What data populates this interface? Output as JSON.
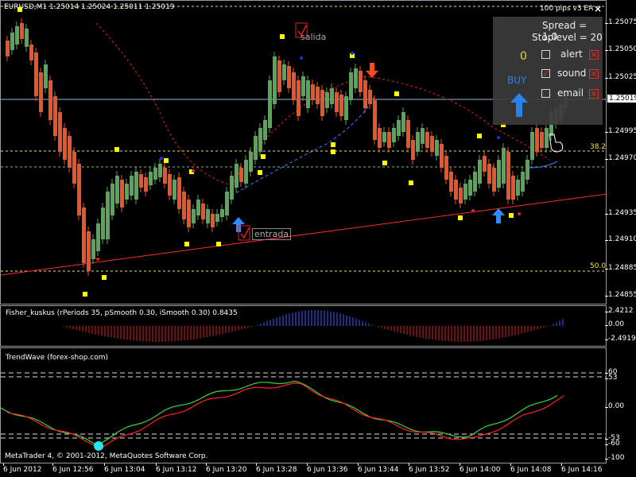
{
  "main": {
    "symbol_header": "EURUSD,M1  1.25014 1.25024 1.25011 1.25019",
    "ea_title": "100 pips v3 EA",
    "close_glyph": "×",
    "current_price": "1.25019",
    "y_ticks": [
      "1.25075",
      "1.25050",
      "1.25025",
      "1.24995",
      "1.24970",
      "1.24935",
      "1.24910",
      "1.24885",
      "1.24855"
    ],
    "fib_38": "38.2",
    "fib_50": "50.0",
    "salida_label": "salida",
    "entrada_label": "entrada"
  },
  "ea_panel": {
    "spread": "Spread = 1.0",
    "stoplevel": "Stoplevel = 20",
    "counter": "0",
    "alert_label": "alert",
    "sound_label": "sound",
    "email_label": "email",
    "buy_label": "BUY",
    "x_glyph": "×",
    "check_glyph": "✓"
  },
  "fisher": {
    "header": "Fisher_kuskus  (rPeriods 35, pSmooth 0.30, iSmooth 0.30)   0.8435",
    "y_ticks": [
      "2.4212",
      "0.00",
      "-2.4919"
    ]
  },
  "trendwave": {
    "header": "TrendWave (forex-shop.com)",
    "y_ticks": [
      "60",
      "53",
      "0.00",
      "-53",
      "-60",
      "-100"
    ],
    "copyright": "MetaTrader 4, © 2001-2012, MetaQuotes Software Corp."
  },
  "x_axis": [
    "6 Jun 2012",
    "6 Jun 12:56",
    "6 Jun 13:04",
    "6 Jun 13:12",
    "6 Jun 13:20",
    "6 Jun 13:28",
    "6 Jun 13:36",
    "6 Jun 13:44",
    "6 Jun 13:52",
    "6 Jun 14:00",
    "6 Jun 14:08",
    "6 Jun 14:16"
  ],
  "colors": {
    "bull": "#5aa55a",
    "bear": "#e8552a",
    "signal": "#ffff00",
    "support": "#ff2a2a",
    "ma": "#3a7cff",
    "buy_arrow": "#2b8cff",
    "sell_arrow": "#ff4a1a",
    "trend_green": "#3bd63b",
    "trend_red": "#ff2020"
  }
}
